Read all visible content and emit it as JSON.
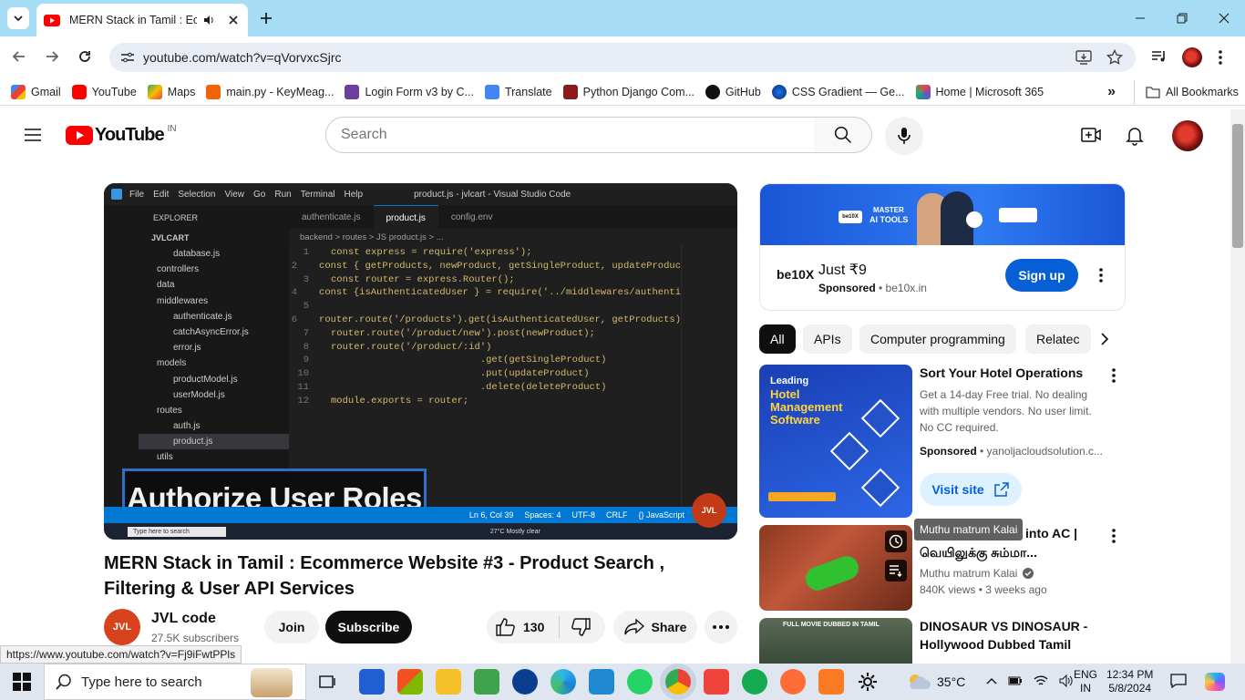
{
  "browser": {
    "tab_title": "MERN Stack in Tamil : Ecom",
    "url": "youtube.com/watch?v=qVorvxcSjrc",
    "status_url": "https://www.youtube.com/watch?v=Fj9iFwtPPls",
    "bookmarks": [
      "Gmail",
      "YouTube",
      "Maps",
      "main.py - KeyMeag...",
      "Login Form v3 by C...",
      "Translate",
      "Python Django Com...",
      "GitHub",
      "CSS Gradient — Ge...",
      "Home | Microsoft 365"
    ],
    "all_bookmarks": "All Bookmarks"
  },
  "youtube": {
    "logo_text": "YouTube",
    "country": "IN",
    "search_placeholder": "Search"
  },
  "video": {
    "title": "MERN Stack in Tamil : Ecommerce Website #3 - Product Search , Filtering & User API Services",
    "channel": "JVL code",
    "subscribers": "27.5K subscribers",
    "join": "Join",
    "subscribe": "Subscribe",
    "likes": "130",
    "share": "Share",
    "channel_avatar_text": "JVL"
  },
  "player": {
    "menu": [
      "File",
      "Edit",
      "Selection",
      "View",
      "Go",
      "Run",
      "Terminal",
      "Help"
    ],
    "window_title": "product.js - jvlcart - Visual Studio Code",
    "tabs": [
      "authenticate.js",
      "product.js",
      "config.env"
    ],
    "explorer_label": "EXPLORER",
    "project": "JVLCART",
    "tree": [
      "database.js",
      "controllers",
      "data",
      "middlewares",
      "authenticate.js",
      "catchAsyncError.js",
      "error.js",
      "models",
      "productModel.js",
      "userModel.js",
      "routes",
      "auth.js",
      "product.js",
      "utils"
    ],
    "breadcrumb": "backend > routes > JS product.js > ...",
    "lines": [
      "const express = require('express');",
      "const { getProducts, newProduct, getSingleProduct, updateProduc",
      "const router = express.Router();",
      "const {isAuthenticatedUser } = require('../middlewares/authenti",
      "",
      "router.route('/products').get(isAuthenticatedUser, getProducts)",
      "router.route('/product/new').post(newProduct);",
      "router.route('/product/:id')",
      "                          .get(getSingleProduct)",
      "                          .put(updateProduct)",
      "                          .delete(deleteProduct)",
      "module.exports = router;"
    ],
    "overlay_caption": "Authorize User Roles",
    "status_items": [
      "Ln 6, Col 39",
      "Spaces: 4",
      "UTF-8",
      "CRLF",
      "{} JavaScript"
    ],
    "taskbar_search": "Type here to search",
    "weather": "27°C Mostly clear"
  },
  "ad": {
    "banner_line1": "MASTER",
    "banner_line2": "AI TOOLS",
    "title": "Just ₹9",
    "sponsored": "Sponsored",
    "domain": "be10x.in",
    "cta": "Sign up",
    "logo": "be10X"
  },
  "chips": [
    "All",
    "APIs",
    "Computer programming",
    "Relatec"
  ],
  "recommendations": [
    {
      "thumb_lines": [
        "Leading",
        "Hotel",
        "Management",
        "Software"
      ],
      "title": "Sort Your Hotel Operations",
      "desc": "Get a 14-day Free trial. No dealing with multiple vendors. No user limit. No CC required.",
      "sponsored": "Sponsored",
      "domain": "yanoljacloudsolution.c...",
      "cta": "Visit site"
    },
    {
      "title_line1": "into AC |",
      "title_line2": "வெயிலுக்கு சும்மா...",
      "tooltip": "Muthu matrum Kalai",
      "channel": "Muthu matrum Kalai",
      "meta": "840K views  •  3 weeks ago"
    },
    {
      "title": "DINOSAUR VS DINOSAUR - Hollywood Dubbed Tamil Movi...",
      "thumb_text": "FULL MOVIE DUBBED IN TAMIL"
    }
  ],
  "taskbar": {
    "search_placeholder": "Type here to search",
    "temp": "35°C",
    "lang1": "ENG",
    "lang2": "IN",
    "time": "12:34 PM",
    "date": "5/8/2024"
  }
}
